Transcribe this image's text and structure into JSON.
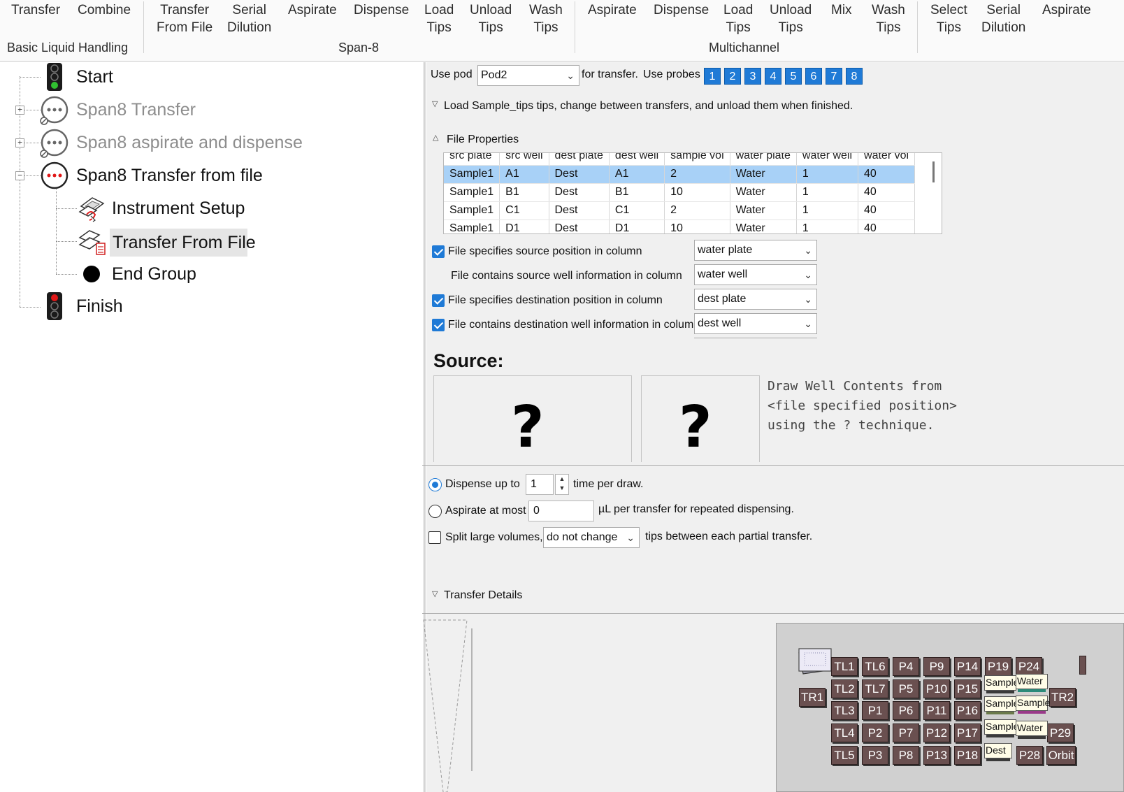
{
  "ribbon": {
    "buttons": {
      "transfer": "Transfer",
      "combine": "Combine",
      "transfer_from_file_1": "Transfer",
      "transfer_from_file_2": "From File",
      "serial_dilution_1": "Serial",
      "serial_dilution_2": "Dilution",
      "span8_aspirate": "Aspirate",
      "span8_dispense": "Dispense",
      "load_tips_1": "Load",
      "load_tips_2": "Tips",
      "unload_tips_1": "Unload",
      "unload_tips_2": "Tips",
      "wash_tips_1": "Wash",
      "wash_tips_2": "Tips",
      "mc_aspirate": "Aspirate",
      "mc_dispense": "Dispense",
      "mc_load_1": "Load",
      "mc_load_2": "Tips",
      "mc_unload_1": "Unload",
      "mc_unload_2": "Tips",
      "mc_mix": "Mix",
      "mc_wash_1": "Wash",
      "mc_wash_2": "Tips",
      "select_tips_1": "Select",
      "select_tips_2": "Tips",
      "g4_serial_1": "Serial",
      "g4_serial_2": "Dilution",
      "g4_aspirate": "Aspirate"
    },
    "groups": {
      "basic": "Basic Liquid Handling",
      "span8": "Span-8",
      "multichannel": "Multichannel"
    }
  },
  "tree": {
    "start": "Start",
    "span8_transfer": "Span8 Transfer",
    "span8_asp_disp": "Span8 aspirate and dispense",
    "span8_from_file": "Span8 Transfer from file",
    "instrument_setup": "Instrument Setup",
    "transfer_from_file": "Transfer From File",
    "end_group": "End Group",
    "finish": "Finish"
  },
  "panel": {
    "use_pod_label": "Use pod",
    "pod_value": "Pod2",
    "for_transfer_label": "for transfer.",
    "use_probes_label": "Use probes",
    "probes": [
      "1",
      "2",
      "3",
      "4",
      "5",
      "6",
      "7",
      "8"
    ],
    "tips_line": "Load Sample_tips tips, change between transfers, and unload them when finished.",
    "file_properties": "File Properties",
    "grid": {
      "columns": [
        "src plate",
        "src well",
        "dest plate",
        "dest well",
        "sample vol",
        "water plate",
        "water well",
        "water vol"
      ],
      "rows": [
        [
          "Sample1",
          "A1",
          "Dest",
          "A1",
          "2",
          "Water",
          "1",
          "40"
        ],
        [
          "Sample1",
          "B1",
          "Dest",
          "B1",
          "10",
          "Water",
          "1",
          "40"
        ],
        [
          "Sample1",
          "C1",
          "Dest",
          "C1",
          "2",
          "Water",
          "1",
          "40"
        ],
        [
          "Sample1",
          "D1",
          "Dest",
          "D1",
          "10",
          "Water",
          "1",
          "40"
        ]
      ]
    },
    "options": [
      {
        "label": "File specifies source position in column",
        "value": "water plate",
        "checked": true
      },
      {
        "label": "File contains source well information in column",
        "value": "water well",
        "checked": null
      },
      {
        "label": "File specifies destination position in column",
        "value": "dest plate",
        "checked": true
      },
      {
        "label": "File contains destination well information in column",
        "value": "dest well",
        "checked": true
      }
    ],
    "source_heading": "Source:",
    "q1": "?",
    "q2": "?",
    "draw_text_1": "Draw Well Contents from",
    "draw_text_2": "<file specified position>",
    "draw_text_3": "using the ? technique.",
    "dispense_label": "Dispense up to",
    "dispense_value": "1",
    "per_draw": "time per draw.",
    "aspirate_label": "Aspirate at most",
    "aspirate_value": "0",
    "per_transfer": "µL per transfer for repeated dispensing.",
    "split_label": "Split large volumes,",
    "split_value": "do not change",
    "split_suffix": "tips between each partial transfer.",
    "transfer_details": "Transfer Details"
  },
  "deck": {
    "positions": [
      "TL1",
      "TL6",
      "P4",
      "P9",
      "P14",
      "P19",
      "P24",
      "TL2",
      "TL7",
      "P5",
      "P10",
      "P15",
      "TR1",
      "TR2",
      "TL3",
      "P1",
      "P6",
      "P11",
      "P16",
      "TL4",
      "P2",
      "P7",
      "P12",
      "P17",
      "P29",
      "TL5",
      "P3",
      "P8",
      "P13",
      "P18",
      "P28",
      "Orbit"
    ],
    "plates": [
      "Sample",
      "Water",
      "Sample",
      "Sample",
      "Sample",
      "Water",
      "Dest"
    ]
  }
}
